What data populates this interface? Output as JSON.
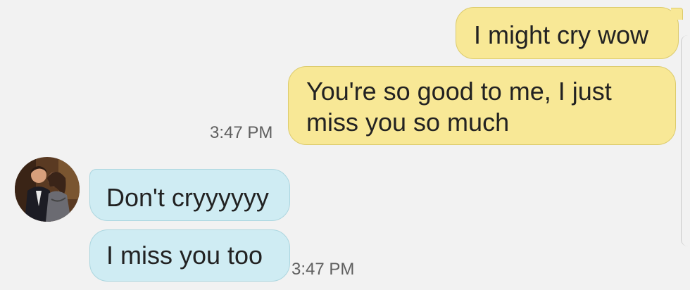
{
  "conversation": {
    "messages": [
      {
        "direction": "sent",
        "text": "I might cry wow"
      },
      {
        "direction": "sent",
        "text": "You're so good to me, I just\nmiss you so much"
      },
      {
        "direction": "received",
        "text": "Don't cryyyyyy"
      },
      {
        "direction": "received",
        "text": "I miss you too"
      }
    ],
    "timestamps": {
      "sent_group": "3:47 PM",
      "received_group": "3:47 PM"
    }
  },
  "colors": {
    "background": "#f2f2f2",
    "sent_bubble": "#f8e896",
    "received_bubble": "#cfecf3",
    "timestamp_text": "#5f5f5f"
  },
  "icons": {
    "contact_avatar": "contact-photo"
  }
}
